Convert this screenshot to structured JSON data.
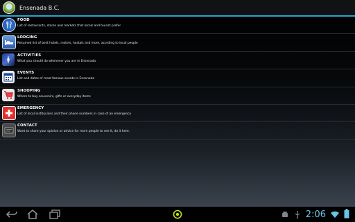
{
  "app": {
    "title": "Ensenada B.C."
  },
  "items": [
    {
      "id": "food",
      "name": "FOOD",
      "desc": "List of restaurants, stores and markets that locals and tourist prefer",
      "icon": "fork-knife-icon"
    },
    {
      "id": "lodging",
      "name": "LODGING",
      "desc": "Resumed list of best hotels, motels, hostals and more, acording to local people",
      "icon": "bed-icon"
    },
    {
      "id": "activities",
      "name": "ACTIVITIES",
      "desc": "What you should do whenever you are in Ensenada",
      "icon": "compass-icon"
    },
    {
      "id": "events",
      "name": "EVENTS",
      "desc": "List and dates of most famous events in Ensenada",
      "icon": "calendar-icon"
    },
    {
      "id": "shopping",
      "name": "SHOOPING",
      "desc": "Where to buy souvenirs, gifts or everyday items",
      "icon": "shopping-cart-icon"
    },
    {
      "id": "emergency",
      "name": "EMERGENCY",
      "desc": "List of local institucions and their phone numbers in case of an emergency",
      "icon": "red-cross-icon"
    },
    {
      "id": "contact",
      "name": "CONTACT",
      "desc": "Want to share your opinion or advice for more people to see it, do it here.",
      "icon": "contact-card-icon"
    }
  ],
  "navbar": {
    "back_icon": "back-arrow-icon",
    "home_icon": "home-icon",
    "recents_icon": "recent-apps-icon",
    "center_icon": "app-indicator-icon"
  },
  "status": {
    "time": "2:06"
  },
  "colors": {
    "accent": "#2aa3d6",
    "clock": "#6cc3e6"
  }
}
